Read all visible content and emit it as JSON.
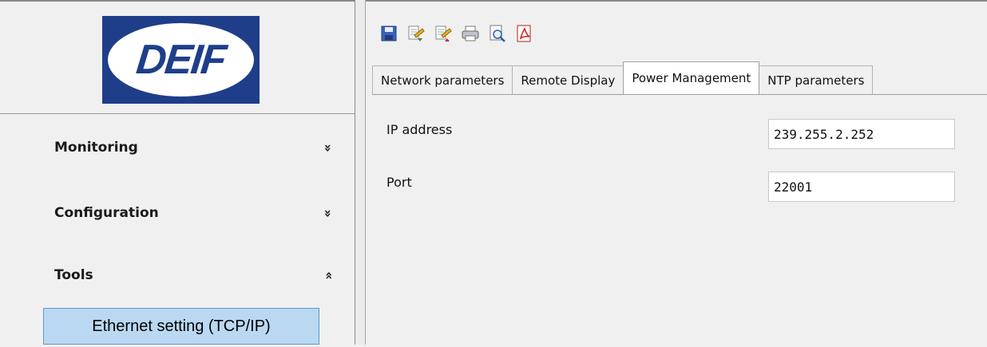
{
  "sidebar": {
    "logo_text": "DEIF",
    "nav": [
      {
        "label": "Monitoring",
        "chevron": "»"
      },
      {
        "label": "Configuration",
        "chevron": "»"
      },
      {
        "label": "Tools",
        "chevron": "»"
      }
    ],
    "active_subitem": "Ethernet setting (TCP/IP)"
  },
  "toolbar": {
    "icons": [
      "save-icon",
      "read-from-device-icon",
      "write-to-device-icon",
      "print-icon",
      "print-preview-icon",
      "export-pdf-icon"
    ]
  },
  "tabs": [
    {
      "label": "Network parameters",
      "active": false
    },
    {
      "label": "Remote Display",
      "active": false
    },
    {
      "label": "Power Management",
      "active": true
    },
    {
      "label": "NTP parameters",
      "active": false
    }
  ],
  "form": {
    "ip_label": "IP address",
    "ip_value": "239.255.2.252",
    "port_label": "Port",
    "port_value": "22001"
  },
  "colors": {
    "logo_blue": "#1f3e8a",
    "active_item_bg": "#bad8f2",
    "active_item_border": "#5b9bd5"
  }
}
